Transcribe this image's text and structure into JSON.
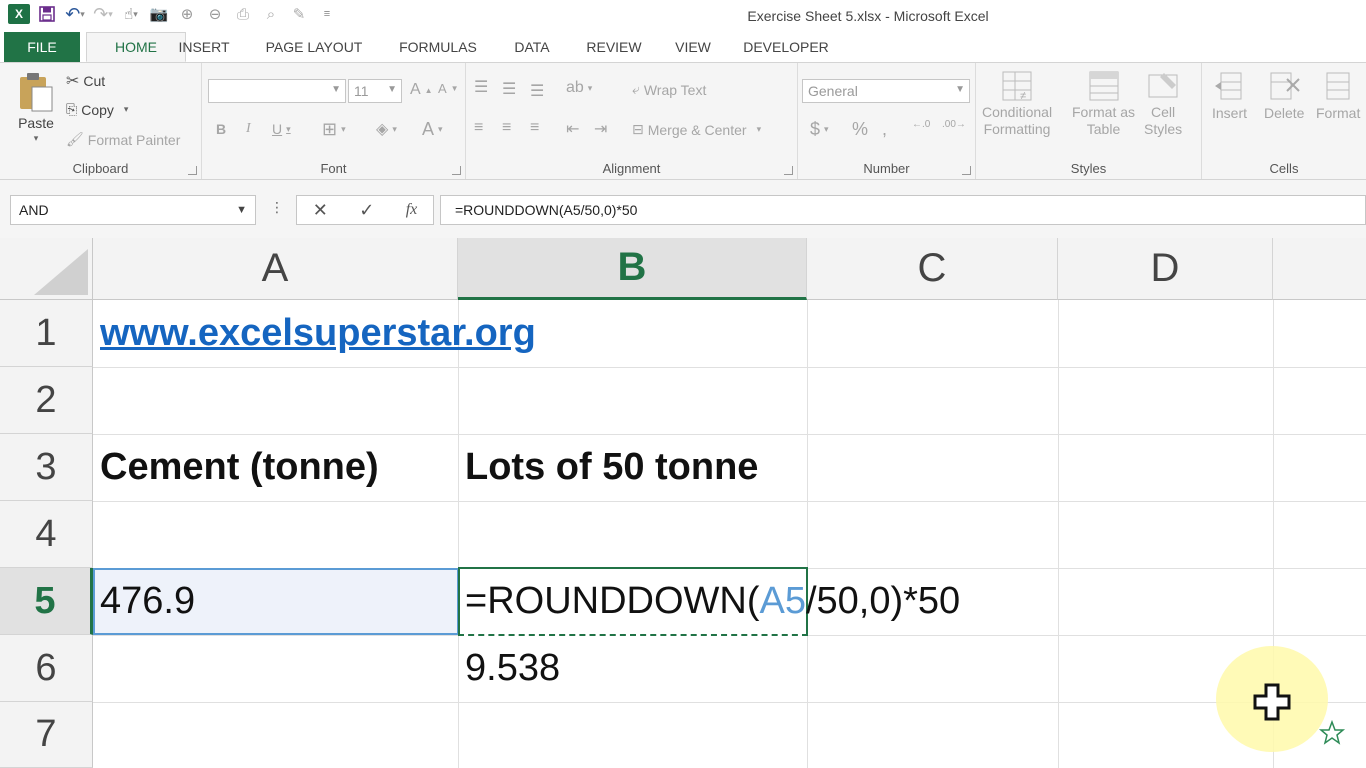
{
  "window": {
    "title": "Exercise Sheet 5.xlsx - Microsoft Excel"
  },
  "ribbon_tabs": [
    {
      "label": "FILE"
    },
    {
      "label": "HOME"
    },
    {
      "label": "INSERT"
    },
    {
      "label": "PAGE LAYOUT"
    },
    {
      "label": "FORMULAS"
    },
    {
      "label": "DATA"
    },
    {
      "label": "REVIEW"
    },
    {
      "label": "VIEW"
    },
    {
      "label": "DEVELOPER"
    }
  ],
  "clipboard": {
    "paste": "Paste",
    "cut": "Cut",
    "copy": "Copy",
    "format_painter": "Format Painter",
    "label": "Clipboard"
  },
  "font": {
    "name": "",
    "size": "11",
    "label": "Font"
  },
  "alignment": {
    "wrap_text": "Wrap Text",
    "merge_center": "Merge & Center",
    "label": "Alignment"
  },
  "number": {
    "format": "General",
    "label": "Number"
  },
  "styles": {
    "conditional_1": "Conditional",
    "conditional_2": "Formatting",
    "format_table_1": "Format as",
    "format_table_2": "Table",
    "cell_styles_1": "Cell",
    "cell_styles_2": "Styles",
    "label": "Styles"
  },
  "cells": {
    "insert": "Insert",
    "delete": "Delete",
    "format": "Format",
    "label": "Cells"
  },
  "formula_bar": {
    "name_box": "AND",
    "formula": "=ROUNDDOWN(A5/50,0)*50"
  },
  "columns": [
    "A",
    "B",
    "C",
    "D"
  ],
  "rows": [
    "1",
    "2",
    "3",
    "4",
    "5",
    "6",
    "7"
  ],
  "cells_data": {
    "a1": "www.excelsuperstar.org",
    "a3": "Cement (tonne)",
    "b3": "Lots of 50 tonne",
    "a5": "476.9",
    "b5_prefix": "=ROUNDDOWN(",
    "b5_ref": "A5",
    "b5_suffix": "/50,0)*50",
    "b6": "9.538"
  },
  "colors": {
    "excel_green": "#217346",
    "reference_blue": "#5b9bd5",
    "link_blue": "#1565c0"
  }
}
